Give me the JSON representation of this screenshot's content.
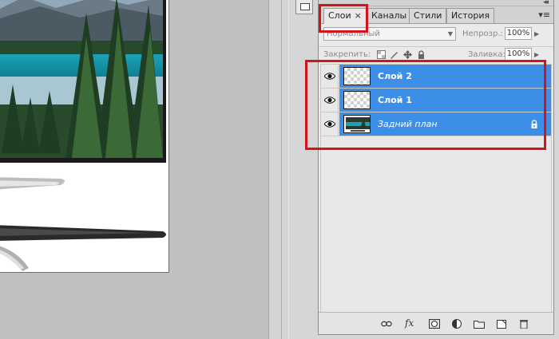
{
  "tabs": [
    {
      "label": "Слои"
    },
    {
      "label": "Каналы"
    },
    {
      "label": "Стили"
    },
    {
      "label": "История"
    }
  ],
  "tab_close_glyph": "×",
  "panel_menu_glyph": "▾≡",
  "panel_collapse_glyph": "◂◂",
  "blend_mode_value": "Нормальный",
  "opacity_label": "Непрозр.:",
  "opacity_value": "100%",
  "lock_label": "Закрепить:",
  "fill_label": "Заливка:",
  "fill_value": "100%",
  "layers": [
    {
      "name": "Слой 2",
      "visible": true,
      "thumbnail": "transparent"
    },
    {
      "name": "Слой 1",
      "visible": true,
      "thumbnail": "transparent"
    },
    {
      "name": "Задний план",
      "visible": true,
      "thumbnail": "photo",
      "locked": true
    }
  ],
  "bottom_icons": [
    "link-icon",
    "fx-icon",
    "mask-icon",
    "adjustment-icon",
    "group-folder-icon",
    "new-layer-icon",
    "trash-icon"
  ],
  "bottom_labels": {
    "fx": "fx"
  },
  "colors": {
    "selection": "#3d8ee6",
    "highlight": "#d4141a",
    "panel_bg": "#eaeaea"
  }
}
